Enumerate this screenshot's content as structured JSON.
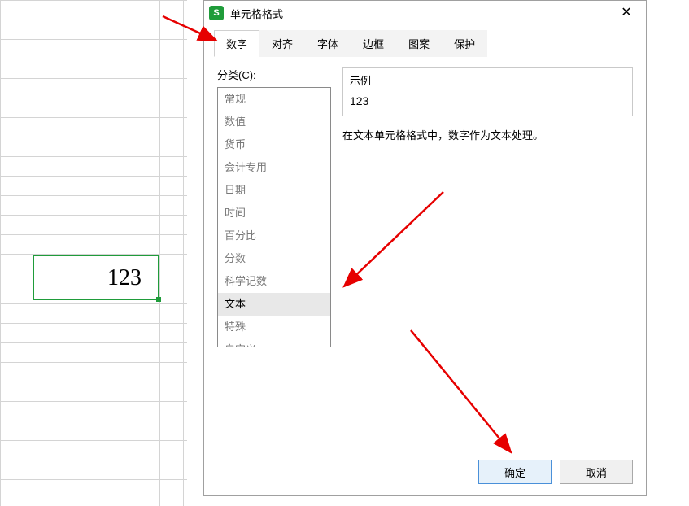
{
  "spreadsheet": {
    "selected_cell_value": "123"
  },
  "dialog": {
    "title": "单元格格式",
    "tabs": [
      {
        "label": "数字"
      },
      {
        "label": "对齐"
      },
      {
        "label": "字体"
      },
      {
        "label": "边框"
      },
      {
        "label": "图案"
      },
      {
        "label": "保护"
      }
    ],
    "category_label": "分类(C):",
    "categories": [
      {
        "label": "常规"
      },
      {
        "label": "数值"
      },
      {
        "label": "货币"
      },
      {
        "label": "会计专用"
      },
      {
        "label": "日期"
      },
      {
        "label": "时间"
      },
      {
        "label": "百分比"
      },
      {
        "label": "分数"
      },
      {
        "label": "科学记数"
      },
      {
        "label": "文本"
      },
      {
        "label": "特殊"
      },
      {
        "label": "自定义"
      }
    ],
    "example_label": "示例",
    "example_value": "123",
    "description": "在文本单元格格式中，数字作为文本处理。",
    "ok_button": "确定",
    "cancel_button": "取消"
  }
}
